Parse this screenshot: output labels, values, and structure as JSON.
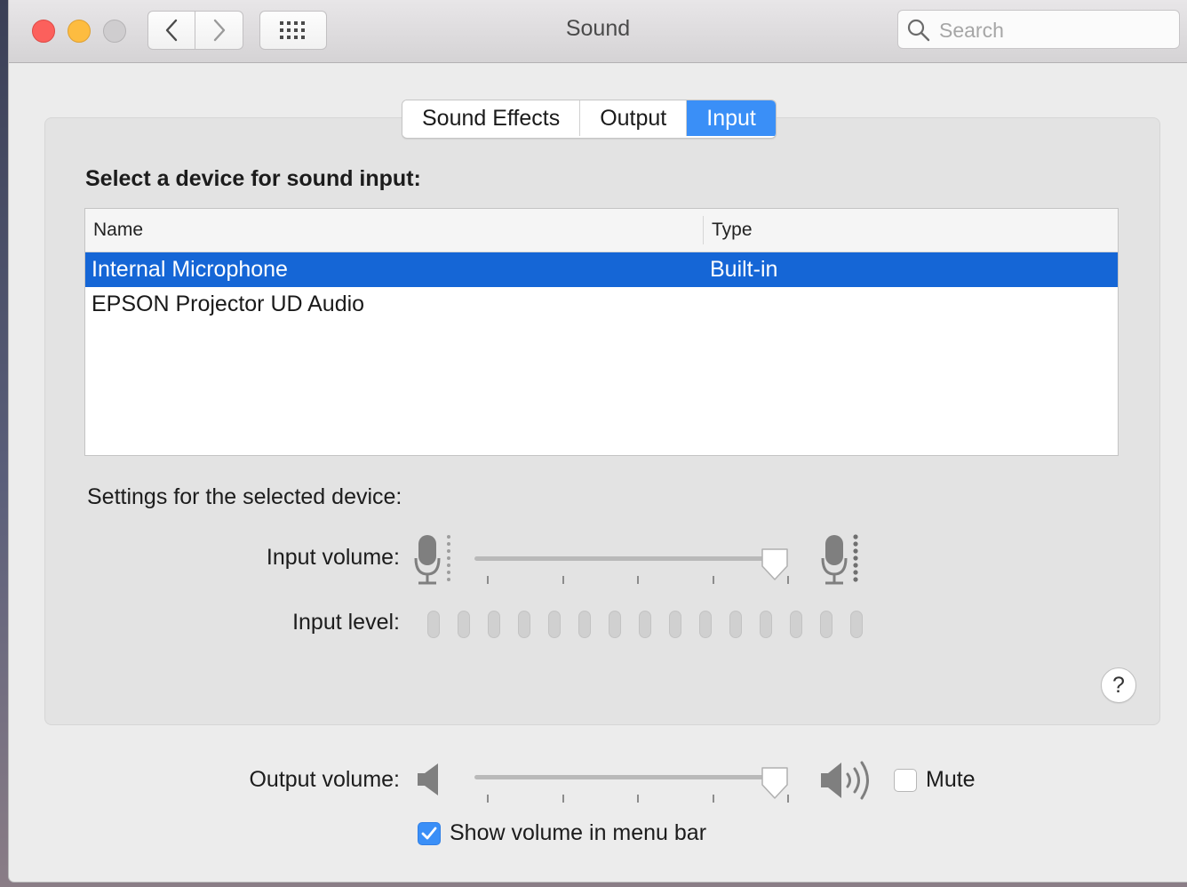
{
  "window": {
    "title": "Sound",
    "search": {
      "placeholder": "Search",
      "value": ""
    }
  },
  "tabs": [
    {
      "label": "Sound Effects",
      "active": false
    },
    {
      "label": "Output",
      "active": false
    },
    {
      "label": "Input",
      "active": true
    }
  ],
  "input_section": {
    "heading": "Select a device for sound input:",
    "columns": {
      "name": "Name",
      "type": "Type"
    },
    "devices": [
      {
        "name": "Internal Microphone",
        "type": "Built-in",
        "selected": true
      },
      {
        "name": "EPSON Projector UD Audio",
        "type": "",
        "selected": false
      }
    ]
  },
  "settings": {
    "heading": "Settings for the selected device:",
    "input_volume_label": "Input volume:",
    "input_volume": 0.95,
    "input_level_label": "Input level:",
    "input_level_segments": 15,
    "input_level_active": 0
  },
  "output": {
    "label": "Output volume:",
    "volume": 0.95,
    "mute_label": "Mute",
    "mute_checked": false,
    "show_in_menu_bar_label": "Show volume in menu bar",
    "show_in_menu_bar_checked": true
  },
  "help_label": "?",
  "colors": {
    "accent": "#3a8ff7",
    "selection": "#1566d6"
  }
}
